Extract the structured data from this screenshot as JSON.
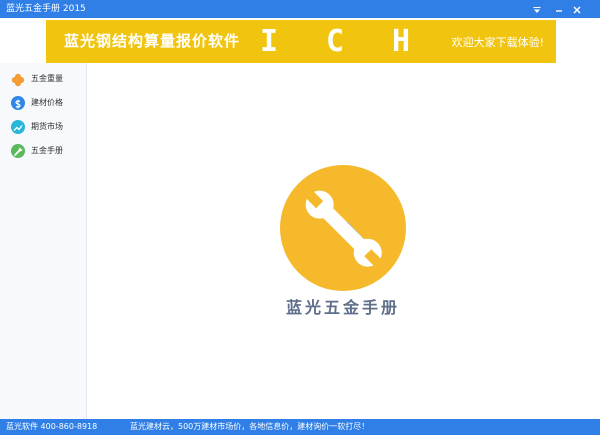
{
  "window": {
    "title": "蓝光五金手册 2015",
    "controls": [
      "menu-icon",
      "minimize-icon",
      "close-icon"
    ]
  },
  "banner": {
    "title": "蓝光钢结构算量报价软件",
    "letters": [
      "I",
      "C",
      "H"
    ],
    "welcome": "欢迎大家下载体验!",
    "background": "#f1c40f"
  },
  "sidebar": {
    "items": [
      {
        "label": "五金重量",
        "icon": "clover-icon",
        "color": "#f39c34"
      },
      {
        "label": "建材价格",
        "icon": "dollar-icon",
        "color": "#2f86e6"
      },
      {
        "label": "期货市场",
        "icon": "trend-icon",
        "color": "#29b6d8"
      },
      {
        "label": "五金手册",
        "icon": "wrench-icon",
        "color": "#5cb85c"
      }
    ]
  },
  "main": {
    "logo_icon": "tools-icon",
    "logo_color": "#f6b92b",
    "logo_name": "蓝光五金手册"
  },
  "statusbar": {
    "left": "蓝光软件 400-860-8918",
    "right": "蓝光建材云，500万建材市场价，各地信息价，建材询价一软打尽！",
    "background": "#2f7fe6"
  }
}
